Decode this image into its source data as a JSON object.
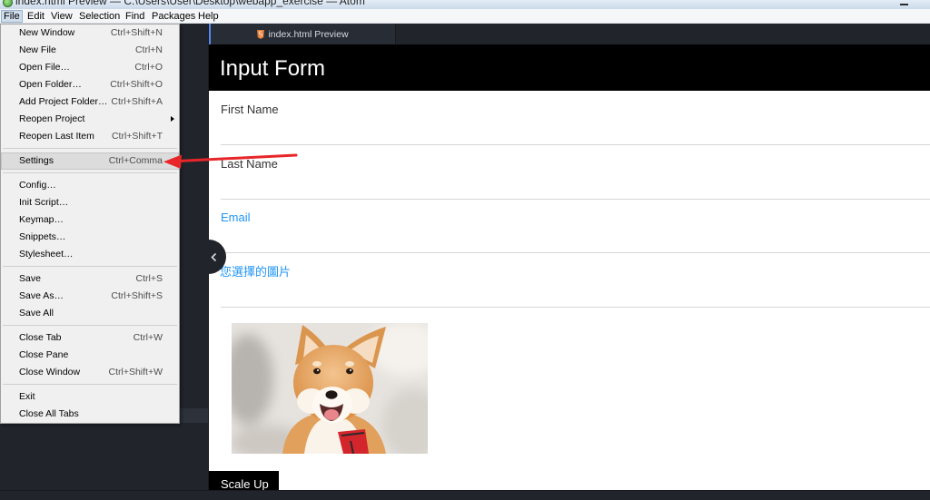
{
  "window": {
    "title": "index.html Preview — C:\\Users\\User\\Desktop\\webapp_exercise — Atom"
  },
  "menubar": {
    "items": [
      {
        "label": "File",
        "open": true
      },
      {
        "label": "Edit"
      },
      {
        "label": "View"
      },
      {
        "label": "Selection"
      },
      {
        "label": "Find"
      },
      {
        "label": "Packages"
      },
      {
        "label": "Help"
      }
    ]
  },
  "file_menu": {
    "groups": [
      {
        "items": [
          {
            "label": "New Window",
            "shortcut": "Ctrl+Shift+N"
          },
          {
            "label": "New File",
            "shortcut": "Ctrl+N"
          },
          {
            "label": "Open File…",
            "shortcut": "Ctrl+O"
          },
          {
            "label": "Open Folder…",
            "shortcut": "Ctrl+Shift+O"
          },
          {
            "label": "Add Project Folder…",
            "shortcut": "Ctrl+Shift+A"
          },
          {
            "label": "Reopen Project",
            "has_submenu": true
          },
          {
            "label": "Reopen Last Item",
            "shortcut": "Ctrl+Shift+T"
          }
        ]
      },
      {
        "items": [
          {
            "label": "Settings",
            "shortcut": "Ctrl+Comma",
            "highlighted": true
          }
        ]
      },
      {
        "items": [
          {
            "label": "Config…"
          },
          {
            "label": "Init Script…"
          },
          {
            "label": "Keymap…"
          },
          {
            "label": "Snippets…"
          },
          {
            "label": "Stylesheet…"
          }
        ]
      },
      {
        "items": [
          {
            "label": "Save",
            "shortcut": "Ctrl+S"
          },
          {
            "label": "Save As…",
            "shortcut": "Ctrl+Shift+S"
          },
          {
            "label": "Save All"
          }
        ]
      },
      {
        "items": [
          {
            "label": "Close Tab",
            "shortcut": "Ctrl+W"
          },
          {
            "label": "Close Pane"
          },
          {
            "label": "Close Window",
            "shortcut": "Ctrl+Shift+W"
          }
        ]
      },
      {
        "items": [
          {
            "label": "Exit"
          },
          {
            "label": "Close All Tabs"
          }
        ]
      }
    ]
  },
  "tab": {
    "title": "index.html Preview",
    "active": true
  },
  "preview": {
    "header": "Input Form",
    "fields": [
      {
        "label": "First Name",
        "color": "#333333"
      },
      {
        "label": "Last Name",
        "color": "#333333"
      },
      {
        "label": "Email",
        "color": "#2196f3"
      },
      {
        "label": "您選擇的圖片",
        "color": "#2196f3"
      }
    ],
    "scale_button": "Scale Up"
  },
  "colors": {
    "accent": "#568af2",
    "editor_bg": "#21252b",
    "header_bg": "#000000",
    "annotation": "#e8262a"
  },
  "icons": {
    "app": "atom-logo-icon",
    "window_minimize": "minimize-icon",
    "tab_file": "html5-icon",
    "submenu": "submenu-arrow-icon",
    "dock_toggle": "chevron-left-icon"
  }
}
